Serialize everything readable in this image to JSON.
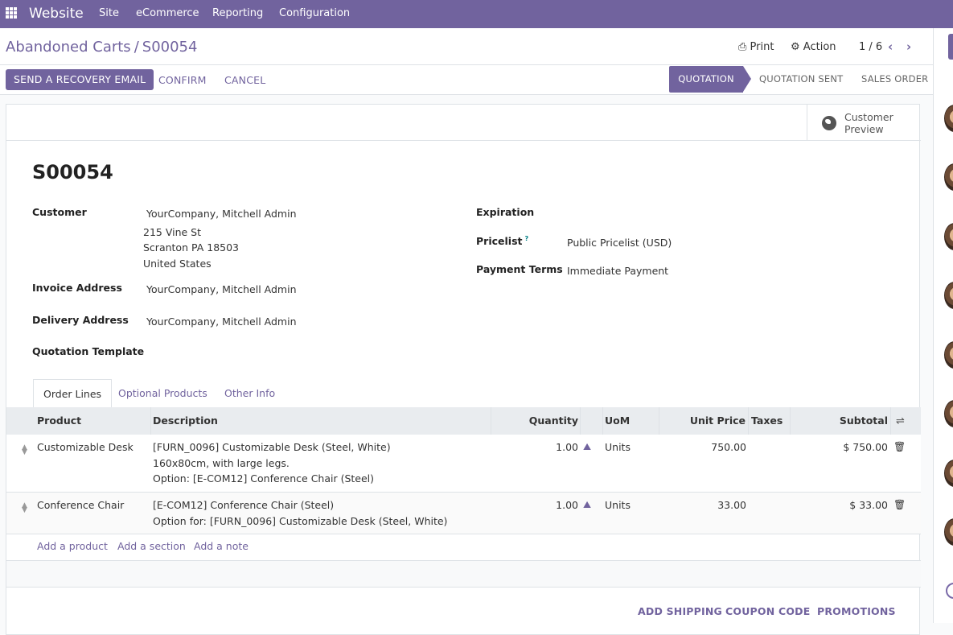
{
  "navbar": {
    "app": "Website",
    "menus": [
      "Site",
      "eCommerce",
      "Reporting",
      "Configuration"
    ]
  },
  "breadcrumb": {
    "parent": "Abandoned Carts",
    "separator": "/",
    "current": "S00054"
  },
  "control": {
    "print": "Print",
    "action": "Action",
    "pager": "1 / 6"
  },
  "actions": {
    "recovery": "SEND A RECOVERY EMAIL",
    "confirm": "CONFIRM",
    "cancel": "CANCEL"
  },
  "statusbar": {
    "stages": [
      "QUOTATION",
      "QUOTATION SENT",
      "SALES ORDER"
    ],
    "active": "QUOTATION"
  },
  "stat_button": {
    "label": "Customer Preview"
  },
  "record": {
    "name": "S00054",
    "fields": {
      "customer_label": "Customer",
      "customer": "YourCompany, Mitchell Admin",
      "address": [
        "215 Vine St",
        "Scranton PA 18503",
        "United States"
      ],
      "invoice_label": "Invoice Address",
      "invoice": "YourCompany, Mitchell Admin",
      "delivery_label": "Delivery Address",
      "delivery": "YourCompany, Mitchell Admin",
      "template_label": "Quotation Template",
      "expiration_label": "Expiration",
      "pricelist_label": "Pricelist",
      "pricelist_help": "?",
      "pricelist": "Public Pricelist (USD)",
      "payment_label": "Payment Terms",
      "payment": "Immediate Payment"
    }
  },
  "tabs": [
    "Order Lines",
    "Optional Products",
    "Other Info"
  ],
  "table": {
    "columns": [
      "Product",
      "Description",
      "Quantity",
      "UoM",
      "Unit Price",
      "Taxes",
      "Subtotal"
    ],
    "rows": [
      {
        "product": "Customizable Desk",
        "description": [
          "[FURN_0096] Customizable Desk (Steel, White)",
          "160x80cm, with large legs.",
          "Option: [E-COM12] Conference Chair (Steel)"
        ],
        "quantity": "1.00",
        "uom": "Units",
        "unit_price": "750.00",
        "taxes": "",
        "subtotal": "$ 750.00"
      },
      {
        "product": "Conference Chair",
        "description": [
          "[E-COM12] Conference Chair (Steel)",
          "Option for: [FURN_0096] Customizable Desk (Steel, White)"
        ],
        "quantity": "1.00",
        "uom": "Units",
        "unit_price": "33.00",
        "taxes": "",
        "subtotal": "$ 33.00"
      }
    ],
    "add_links": [
      "Add a product",
      "Add a section",
      "Add a note"
    ]
  },
  "footer_buttons": [
    "ADD SHIPPING",
    "COUPON CODE",
    "PROMOTIONS"
  ],
  "colors": {
    "brand": "#71639e",
    "link": "#71639e"
  }
}
